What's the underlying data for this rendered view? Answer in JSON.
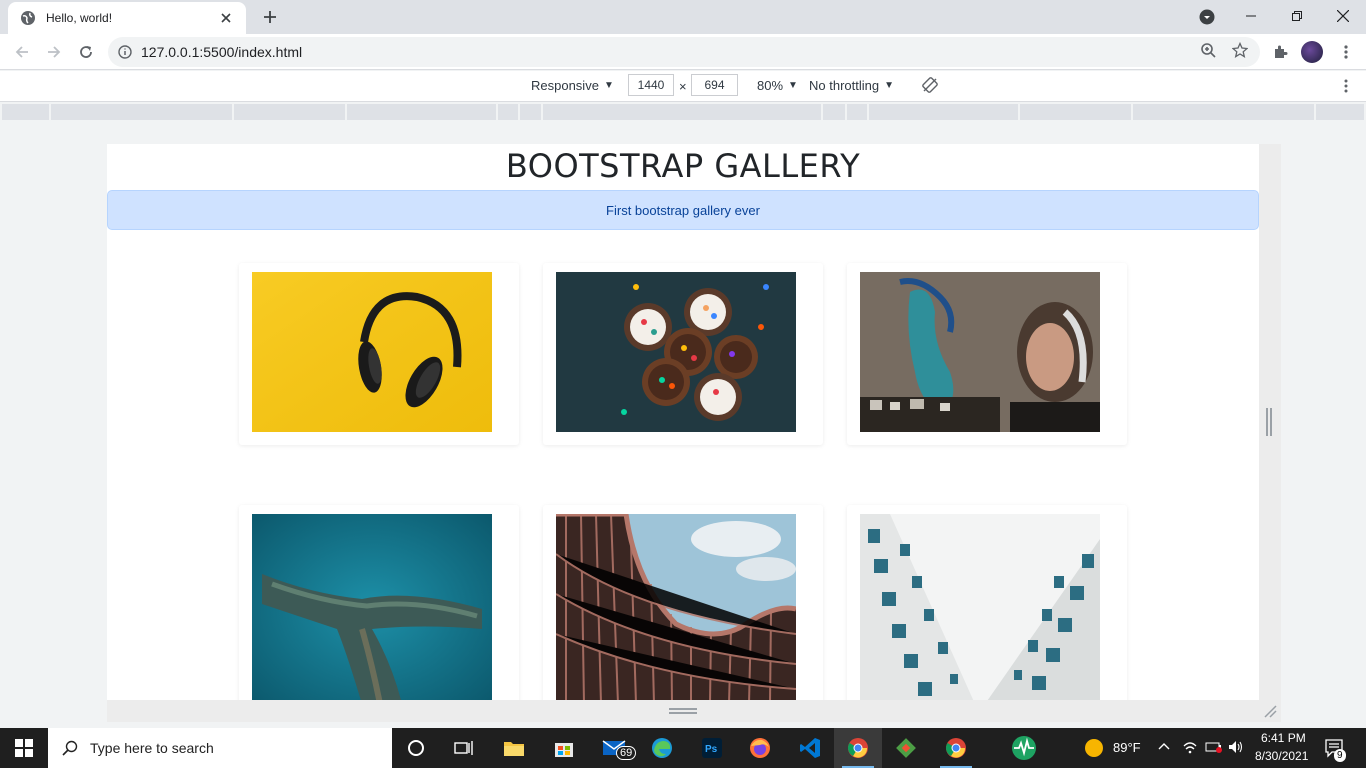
{
  "browser": {
    "tab_title": "Hello, world!",
    "url": "127.0.0.1:5500/index.html"
  },
  "device_toolbar": {
    "mode": "Responsive",
    "width": "1440",
    "times": "×",
    "height": "694",
    "zoom": "80%",
    "throttling": "No throttling"
  },
  "page": {
    "title": "BOOTSTRAP GALLERY",
    "alert": "First bootstrap gallery ever",
    "gallery": [
      {
        "name": "headphones-image",
        "subject": "headphones on yellow background"
      },
      {
        "name": "cupcakes-image",
        "subject": "cupcakes with sprinkles"
      },
      {
        "name": "graffiti-image",
        "subject": "graffiti wall with person"
      },
      {
        "name": "reef-image",
        "subject": "aerial ocean reef"
      },
      {
        "name": "curved-building-image",
        "subject": "curved building facade"
      },
      {
        "name": "white-buildings-image",
        "subject": "white apartment buildings"
      }
    ]
  },
  "taskbar": {
    "search_placeholder": "Type here to search",
    "mail_badge": "69",
    "weather": "89°F",
    "time": "6:41 PM",
    "date": "8/30/2021",
    "notifications": "9"
  },
  "colors": {
    "alert_bg": "#cfe2ff",
    "alert_text": "#084298",
    "taskbar_bg": "#1f1f1f"
  }
}
